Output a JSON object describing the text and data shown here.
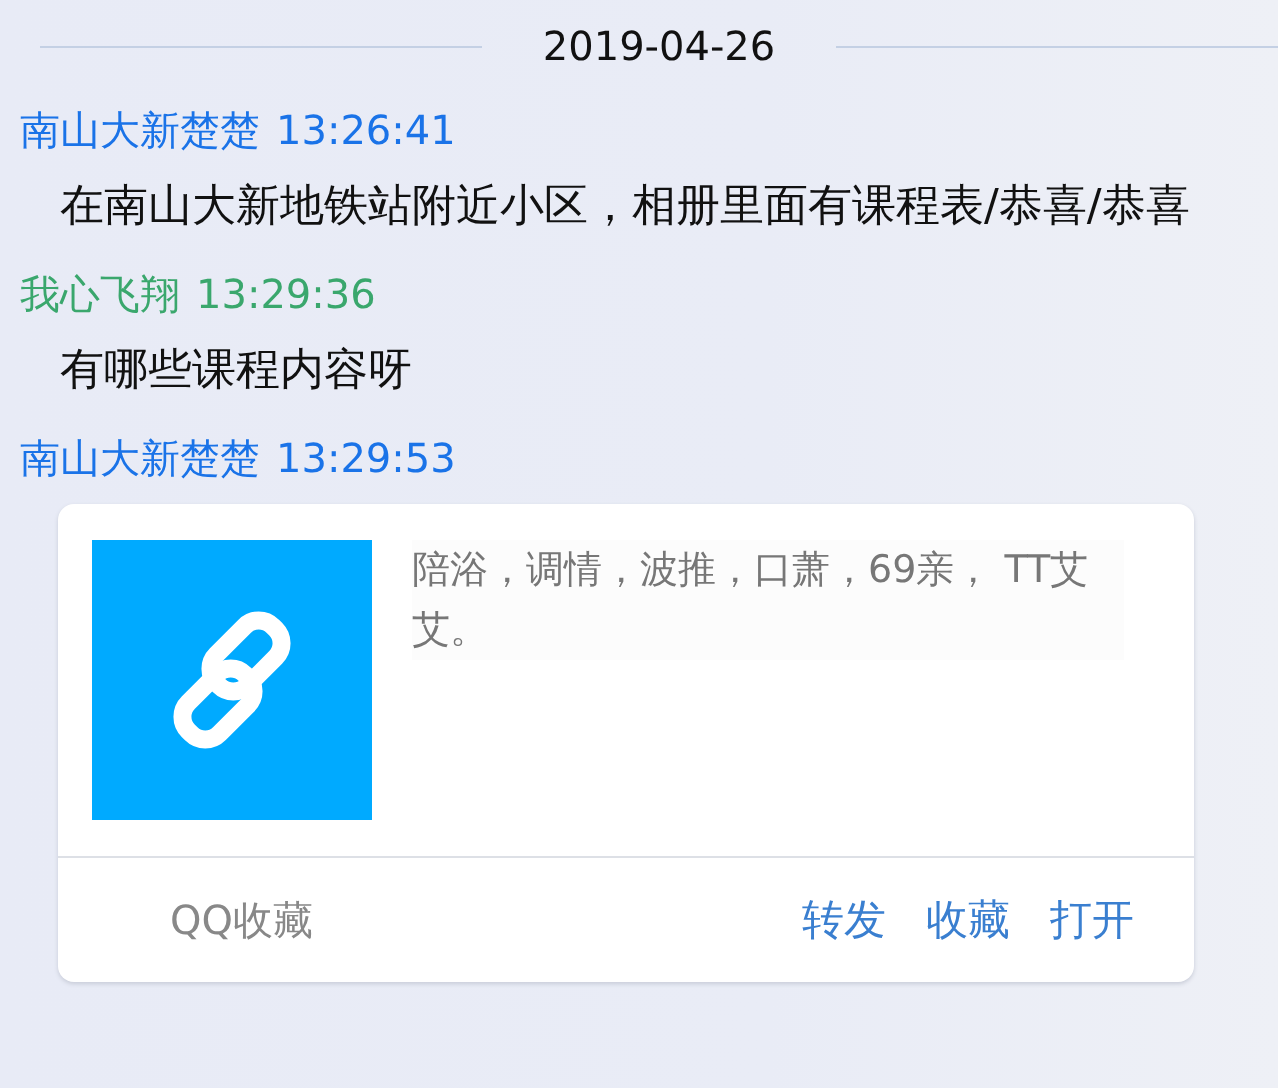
{
  "date": "2019-04-26",
  "messages": [
    {
      "kind": "text",
      "sender": "南山大新楚楚",
      "time": "13:26:41",
      "color": "#1a73e8",
      "text": "在南山大新地铁站附近小区，相册里面有课程表/恭喜/恭喜"
    },
    {
      "kind": "text",
      "sender": "我心飞翔",
      "time": "13:29:36",
      "color": "#3aa76d",
      "text": "有哪些课程内容呀"
    },
    {
      "kind": "card",
      "sender": "南山大新楚楚",
      "time": "13:29:53",
      "color": "#1a73e8",
      "text": "陪浴，调情，波推，口萧，69亲， TT艾艾。",
      "source": "QQ收藏",
      "actions": [
        "转发",
        "收藏",
        "打开"
      ]
    }
  ]
}
